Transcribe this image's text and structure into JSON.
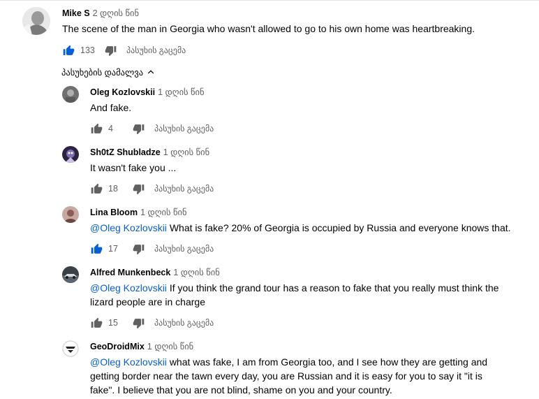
{
  "top_comment": {
    "author": "Mike S",
    "time": "2 დღის წინ",
    "text": "The scene of the man in Georgia who wasn't allowed to go to his own home was heartbreaking.",
    "likes": "133",
    "reply_label": "პასუხის გაცემა"
  },
  "replies_toggle": {
    "label": "პასუხების დამალვა"
  },
  "replies": [
    {
      "author": "Oleg Kozlovskii",
      "time": "1 დღის წინ",
      "mention": "",
      "text": "And fake.",
      "likes": "4",
      "reply_label": "პასუხის გაცემა"
    },
    {
      "author": "Sh0tZ Shubladze",
      "time": "1 დღის წინ",
      "mention": "",
      "text": "It wasn't fake you ...",
      "likes": "18",
      "reply_label": "პასუხის გაცემა"
    },
    {
      "author": "Lina Bloom",
      "time": "1 დღის წინ",
      "mention": "@Oleg Kozlovskii",
      "text": "What is fake? 20% of Georgia is occupied by Russia and everyone knows that.",
      "likes": "17",
      "reply_label": "პასუხის გაცემა"
    },
    {
      "author": "Alfred Munkenbeck",
      "time": "1 დღის წინ",
      "mention": "@Oleg Kozlovskii",
      "text": "If you think the grand tour has a reason to fake that you really must think the lizard people are in charge",
      "likes": "15",
      "reply_label": "პასუხის გაცემა"
    },
    {
      "author": "GeoDroidMix",
      "time": "1 დღის წინ",
      "mention": "@Oleg Kozlovskii",
      "text": "what was fake, I am from Georgia too, and I see how they are getting and getting border near the tawn every day,  you  are Russian and it is easy for you to say it \"it is fake\". I believe that you are not blind, shame on you and your country."
    }
  ],
  "colors": {
    "liked": "#065fd4",
    "icon": "#606060",
    "mention": "#065fd4"
  }
}
